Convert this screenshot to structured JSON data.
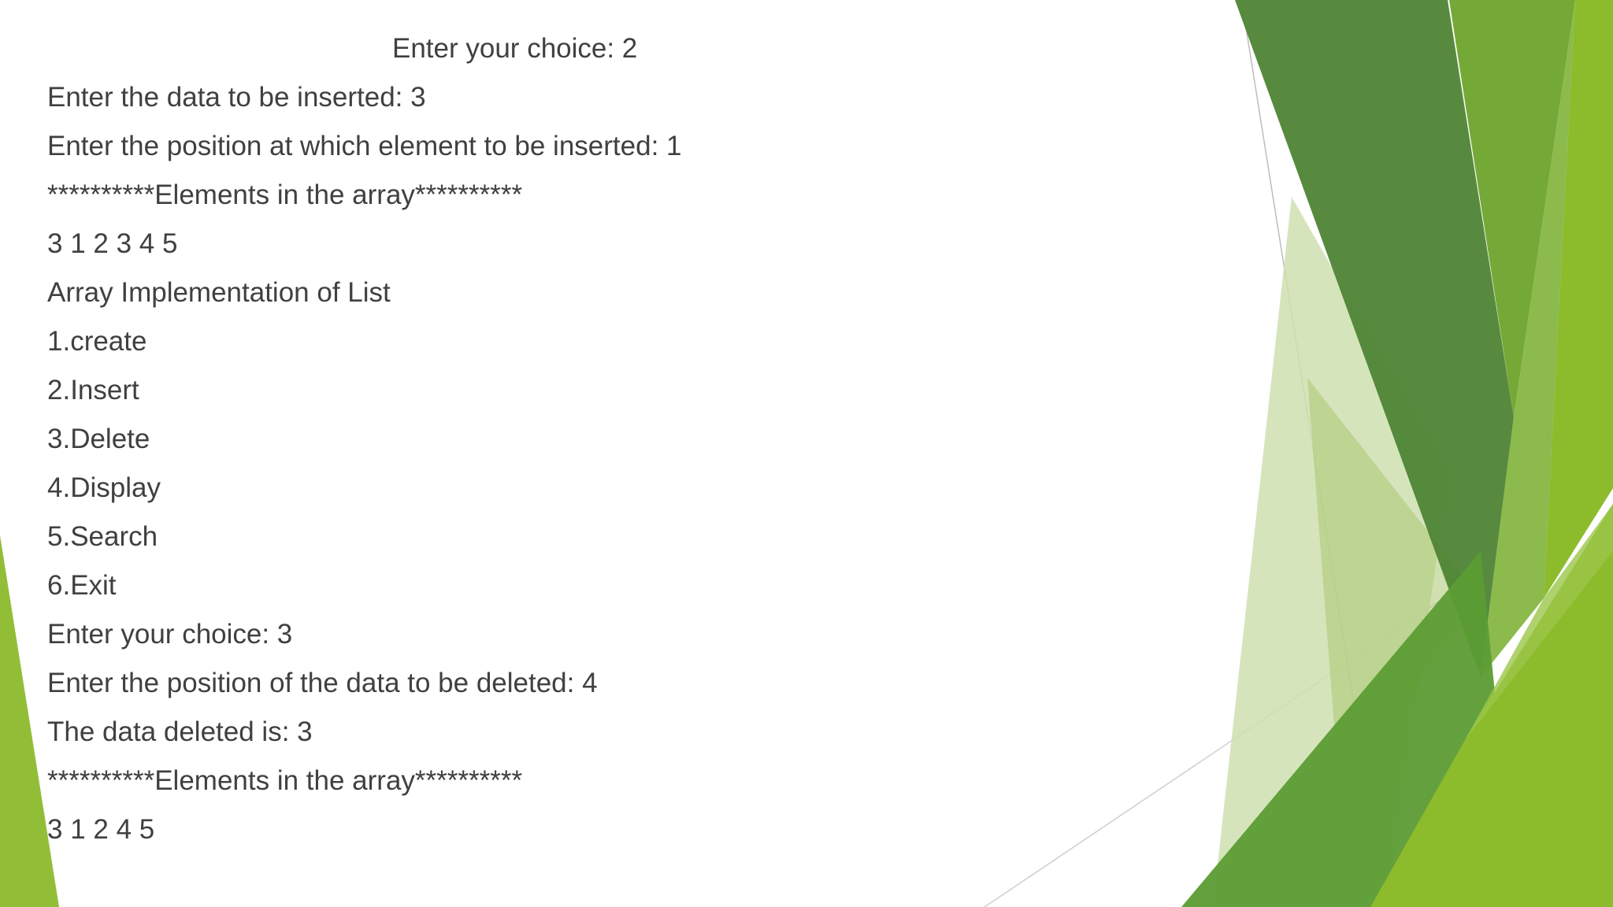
{
  "slide": {
    "lines": [
      "Enter your choice: 2",
      "Enter the data to be inserted: 3",
      "Enter the position at which element to be inserted: 1",
      "**********Elements in the array**********",
      "3 1 2 3 4 5",
      "Array Implementation of List",
      "1.create",
      "2.Insert",
      "3.Delete",
      "4.Display",
      "5.Search",
      "6.Exit",
      "Enter your choice: 3",
      "Enter the position of the data to be deleted: 4",
      "The data deleted is: 3",
      "**********Elements in the array**********",
      "3 1 2 4 5"
    ]
  },
  "theme": {
    "text_color": "#404040",
    "background": "#ffffff",
    "green_dark": "#4e8434",
    "green_mid": "#6ea42c",
    "green_light": "#8cbb2c",
    "green_pale": "#cfdfb0"
  }
}
